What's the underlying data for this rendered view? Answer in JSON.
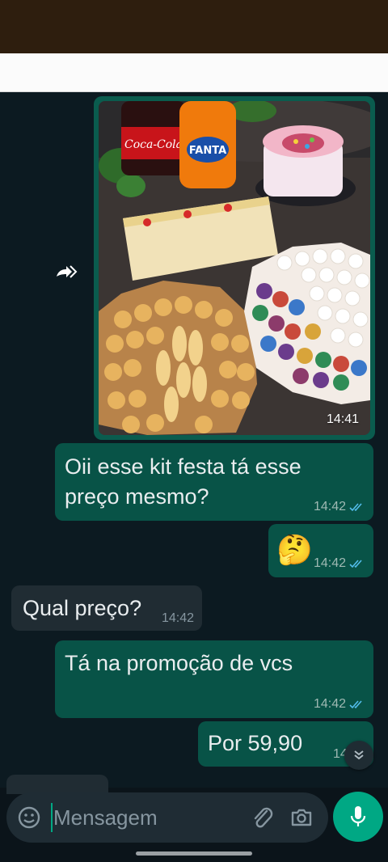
{
  "messages": [
    {
      "type": "image",
      "direction": "outgoing",
      "time": "14:41",
      "forwarded": true
    },
    {
      "type": "text",
      "direction": "outgoing",
      "text": "Oii esse kit festa tá  esse preço mesmo?",
      "line1": "Oii esse kit festa tá  esse",
      "line2": "preço mesmo?",
      "time": "14:42",
      "status": "read"
    },
    {
      "type": "emoji",
      "direction": "outgoing",
      "text": "🤔",
      "time": "14:42",
      "status": "read"
    },
    {
      "type": "text",
      "direction": "incoming",
      "text": "Qual preço?",
      "time": "14:42"
    },
    {
      "type": "text",
      "direction": "outgoing",
      "text": "Tá na promoção de vcs",
      "time": "14:42",
      "status": "read"
    },
    {
      "type": "text",
      "direction": "outgoing",
      "text": "Por 59,90",
      "time": "14:42",
      "status": "read"
    }
  ],
  "image_content": {
    "bottle1_label": "Coca-Cola",
    "bottle2_label": "FANTA"
  },
  "composer": {
    "placeholder": "Mensagem",
    "icons": [
      "emoji-icon",
      "attach-icon",
      "camera-icon",
      "mic-icon"
    ]
  },
  "colors": {
    "chat_background": "#0c1a21",
    "outgoing_bubble": "#085347",
    "incoming_bubble": "#202c33",
    "accent": "#00a884",
    "read_ticks": "#53bdeb"
  }
}
